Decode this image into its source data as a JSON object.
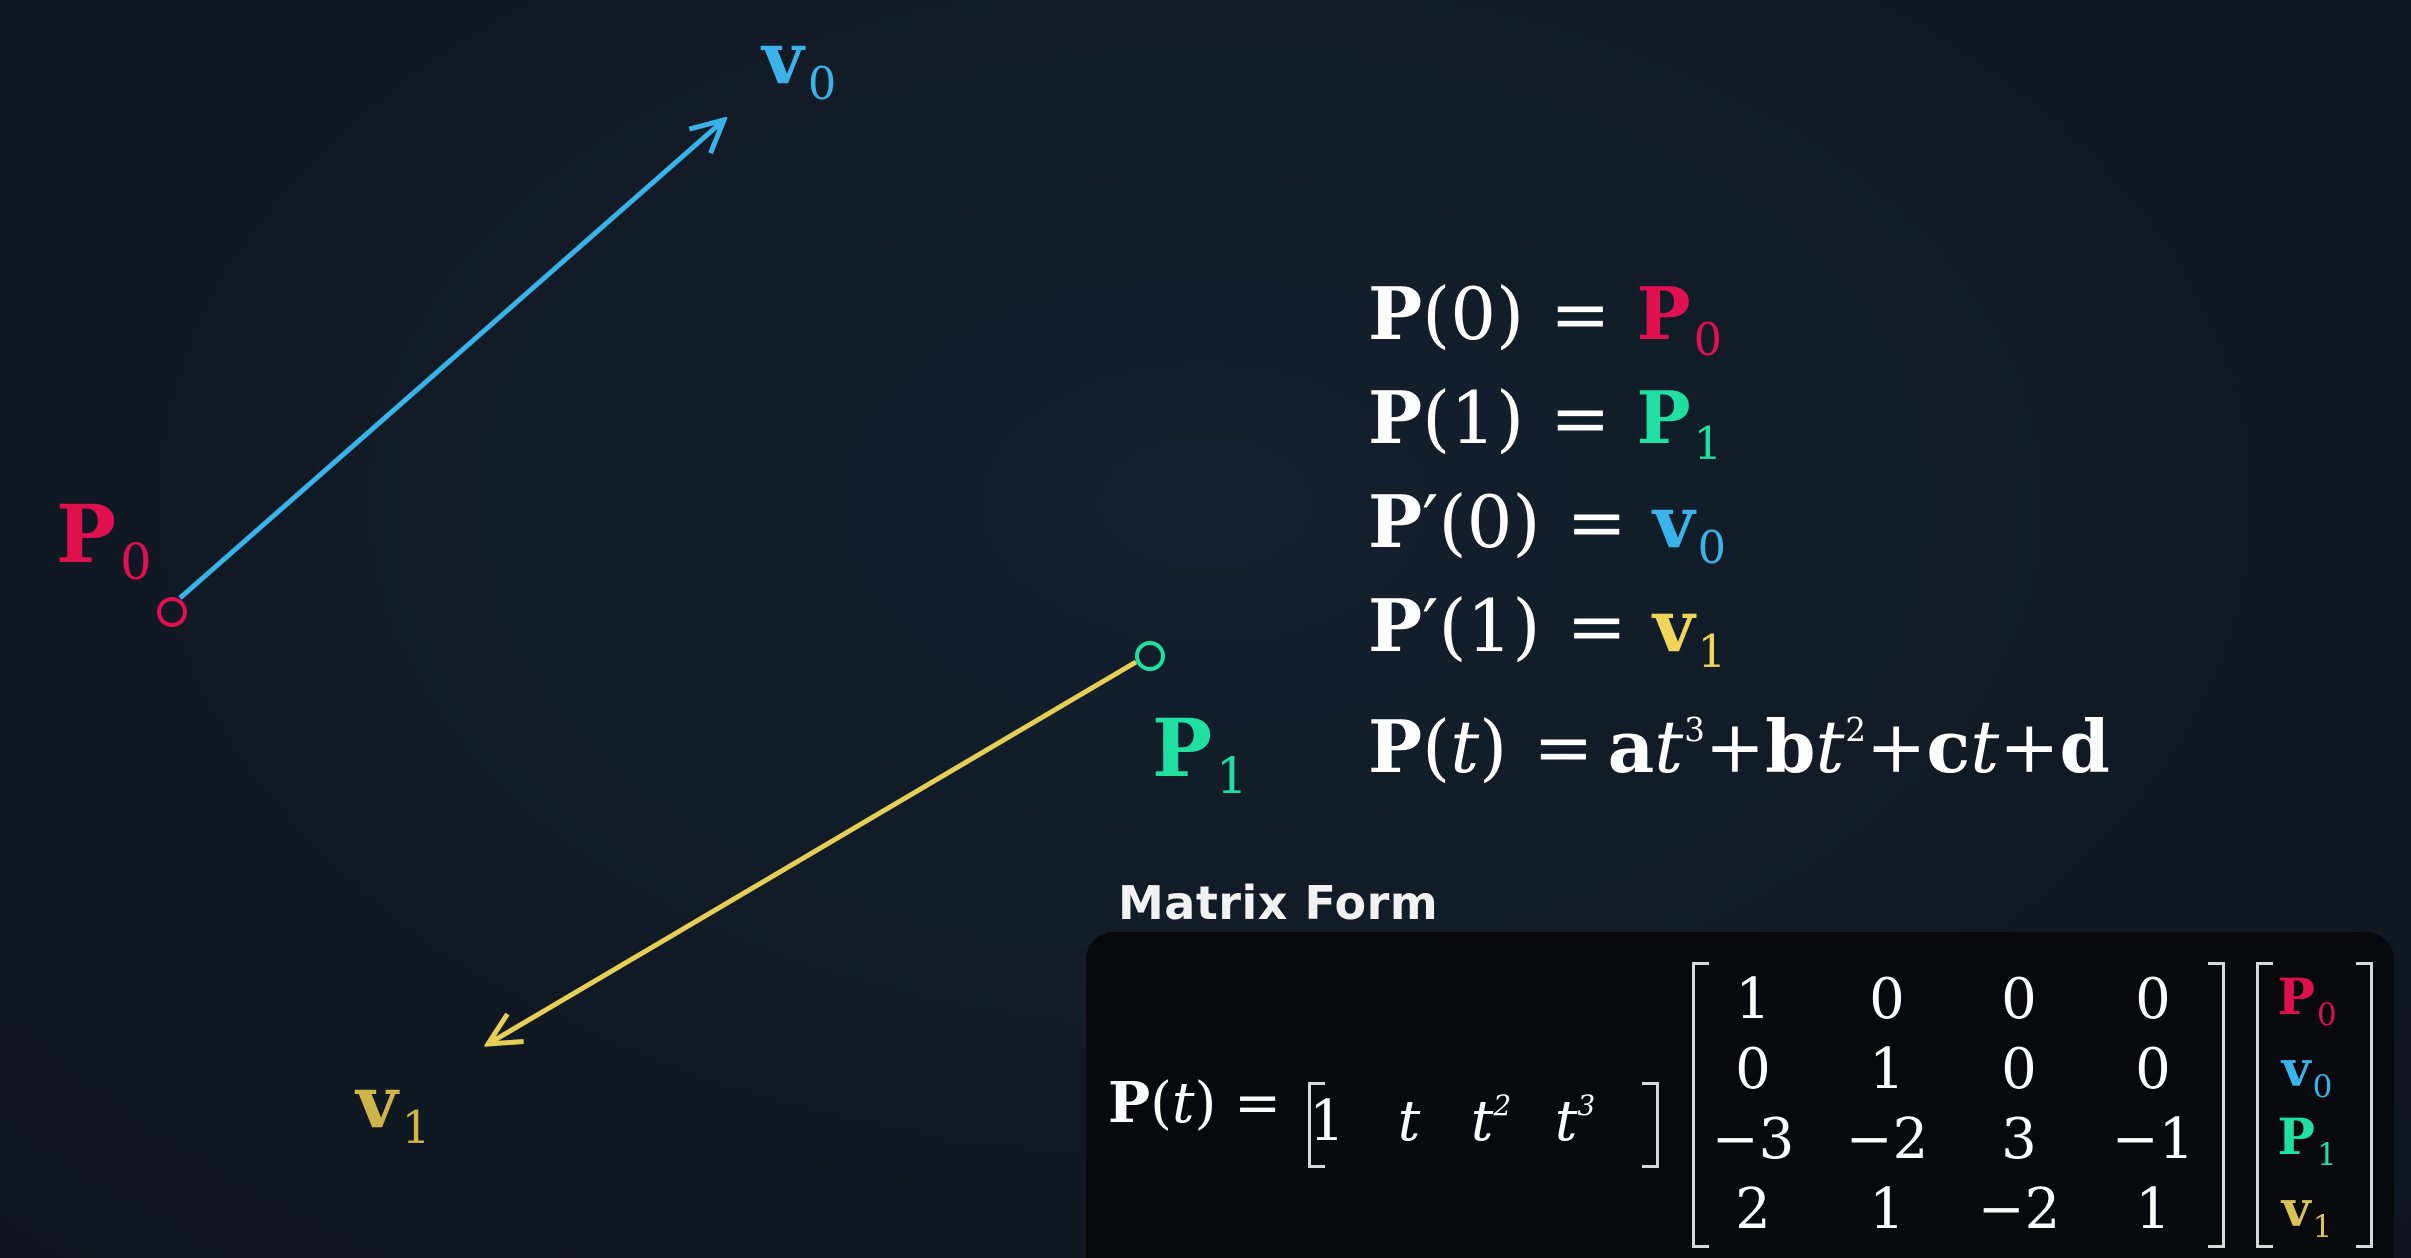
{
  "colors": {
    "p0": "#e0104f",
    "p1": "#1fe0a0",
    "v0": "#3ab3ea",
    "v1": "#f0d55a",
    "background": "#111a24"
  },
  "diagram_labels": {
    "p0": {
      "main": "P",
      "sub": "0"
    },
    "p1": {
      "main": "P",
      "sub": "1"
    },
    "v0": {
      "main": "v",
      "sub": "0"
    },
    "v1": {
      "main": "v",
      "sub": "1"
    }
  },
  "equations": {
    "e1": {
      "lhs": "P",
      "arg": "(0)",
      "eq": "=",
      "rhs": "P",
      "sub": "0"
    },
    "e2": {
      "lhs": "P",
      "arg": "(1)",
      "eq": "=",
      "rhs": "P",
      "sub": "1"
    },
    "e3": {
      "lhs": "P",
      "prime": "′",
      "arg": "(0)",
      "eq": "=",
      "rhs": "v",
      "sub": "0"
    },
    "e4": {
      "lhs": "P",
      "prime": "′",
      "arg": "(1)",
      "eq": "=",
      "rhs": "v",
      "sub": "1"
    },
    "e5": {
      "lhs": "P",
      "open": "(",
      "t": "t",
      "close": ")",
      "eq": "=",
      "a": "a",
      "b": "b",
      "c": "c",
      "d": "d",
      "plus": "+",
      "exp3": "3",
      "exp2": "2"
    }
  },
  "matrix_form": {
    "title": "Matrix Form",
    "lhs": {
      "p": "P",
      "open": "(",
      "t": "t",
      "close": ")",
      "eq": "="
    },
    "row_vector": [
      "1",
      "t",
      "t",
      "t"
    ],
    "row_exponents": [
      "",
      "",
      "2",
      "3"
    ],
    "matrix": [
      [
        "1",
        "0",
        "0",
        "0"
      ],
      [
        "0",
        "1",
        "0",
        "0"
      ],
      [
        "−3",
        "−2",
        "3",
        "−1"
      ],
      [
        "2",
        "1",
        "−2",
        "1"
      ]
    ],
    "vector": [
      {
        "main": "P",
        "sub": "0"
      },
      {
        "main": "v",
        "sub": "0"
      },
      {
        "main": "P",
        "sub": "1"
      },
      {
        "main": "v",
        "sub": "1"
      }
    ]
  }
}
